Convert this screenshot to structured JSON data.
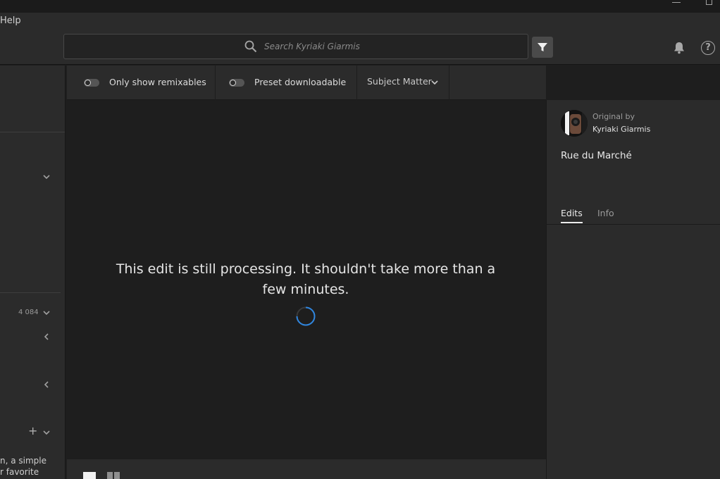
{
  "menu": {
    "help": "Help"
  },
  "search": {
    "placeholder": "Search Kyriaki Giarmis"
  },
  "filters": {
    "remixables_label": "Only show remixables",
    "preset_label": "Preset downloadable",
    "subject_label": "Subject Matter"
  },
  "preview": {
    "message": "This edit is still processing. It shouldn't take more than a few minutes."
  },
  "sidebar": {
    "count": "4 084",
    "snippet_line1": "n, a simple",
    "snippet_line2": "r favorite"
  },
  "panel": {
    "original_by": "Original by",
    "author": "Kyriaki Giarmis",
    "photo_title": "Rue du Marché",
    "tabs": [
      "Edits",
      "Info"
    ]
  },
  "colors": {
    "background": "#1e1e1e",
    "panel": "#2b2b2b",
    "spinner": "#2f86e0"
  },
  "icons": [
    "search-icon",
    "filter-icon",
    "bell-icon",
    "help-icon",
    "chevron-down-icon",
    "chevron-left-icon",
    "plus-icon",
    "spinner-icon"
  ]
}
